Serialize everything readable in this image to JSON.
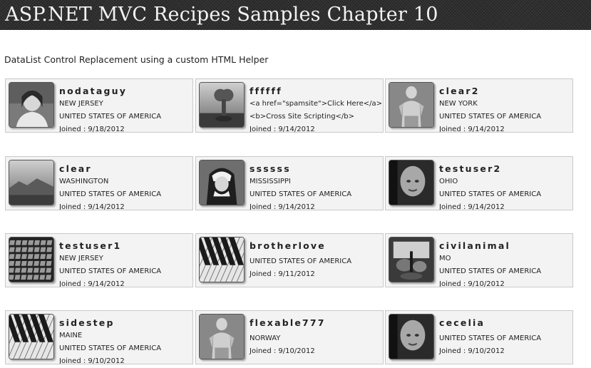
{
  "page": {
    "title": "ASP.NET MVC Recipes Samples Chapter 10",
    "subtitle": "DataList Control Replacement using a custom HTML Helper"
  },
  "users": [
    {
      "username": "nodataguy",
      "line1": "NEW JERSEY",
      "line2": "UNITED STATES OF AMERICA",
      "joined": "Joined : 9/18/2012",
      "photo": "woman-portrait"
    },
    {
      "username": "ffffff",
      "line1": "<a href=\"spamsite\">Click Here</a>",
      "line2": "<b>Cross Site Scripting</b>",
      "joined": "Joined : 9/14/2012",
      "photo": "binocular-viewer"
    },
    {
      "username": "clear2",
      "line1": "NEW YORK",
      "line2": "UNITED STATES OF AMERICA",
      "joined": "Joined : 9/14/2012",
      "photo": "shirtless-man"
    },
    {
      "username": "clear",
      "line1": "WASHINGTON",
      "line2": "UNITED STATES OF AMERICA",
      "joined": "Joined : 9/14/2012",
      "photo": "landscape"
    },
    {
      "username": "ssssss",
      "line1": "MISSISSIPPI",
      "line2": "UNITED STATES OF AMERICA",
      "joined": "Joined : 9/14/2012",
      "photo": "nun"
    },
    {
      "username": "testuser2",
      "line1": "OHIO",
      "line2": "UNITED STATES OF AMERICA",
      "joined": "Joined : 9/14/2012",
      "photo": "bald-man"
    },
    {
      "username": "testuser1",
      "line1": "NEW JERSEY",
      "line2": "UNITED STATES OF AMERICA",
      "joined": "Joined : 9/14/2012",
      "photo": "keyboard"
    },
    {
      "username": "brotherlove",
      "line1": "UNITED STATES OF AMERICA",
      "line2": "Joined : 9/11/2012",
      "joined": "",
      "photo": "piano-keys"
    },
    {
      "username": "civilanimal",
      "line1": "MO",
      "line2": "UNITED STATES OF AMERICA",
      "joined": "Joined : 9/10/2012",
      "photo": "drum-kit"
    },
    {
      "username": "sidestep",
      "line1": "MAINE",
      "line2": "UNITED STATES OF AMERICA",
      "joined": "Joined : 9/10/2012",
      "photo": "piano-keys"
    },
    {
      "username": "flexable777",
      "line1": "NORWAY",
      "line2": "Joined : 9/10/2012",
      "joined": "",
      "photo": "shirtless-man"
    },
    {
      "username": "cecelia",
      "line1": "UNITED STATES OF AMERICA",
      "line2": "Joined : 9/10/2012",
      "joined": "",
      "photo": "bald-man"
    }
  ]
}
